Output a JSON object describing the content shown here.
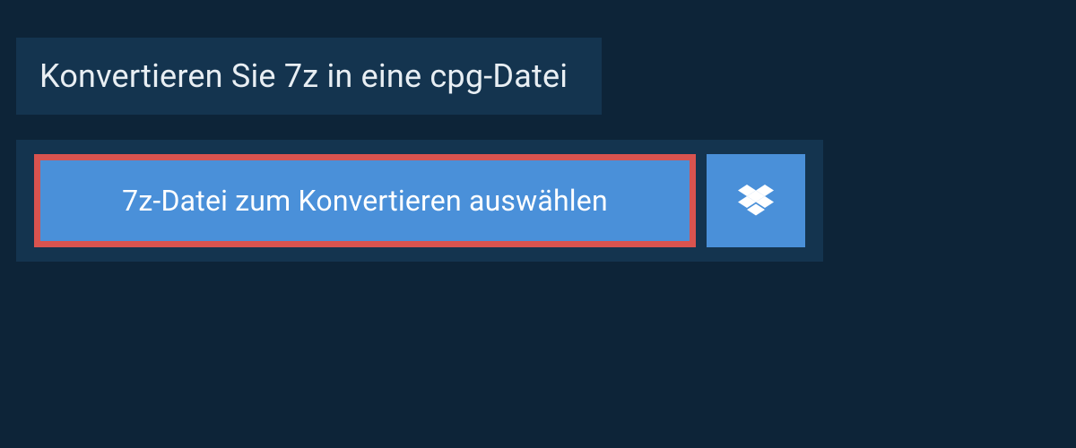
{
  "header": {
    "title": "Konvertieren Sie 7z in eine cpg-Datei"
  },
  "actions": {
    "select_file_label": "7z-Datei zum Konvertieren auswählen"
  },
  "colors": {
    "background": "#0d2438",
    "panel": "#14344f",
    "button_primary": "#4a90d9",
    "button_highlight_border": "#d9534f",
    "text_light": "#ffffff"
  }
}
